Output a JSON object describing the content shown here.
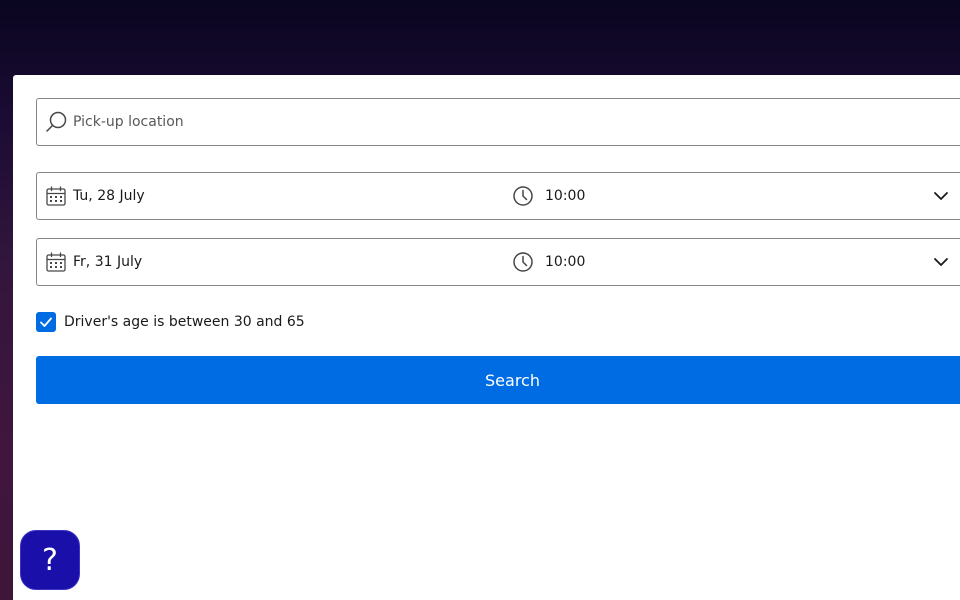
{
  "search": {
    "placeholder": "Pick-up location",
    "icon": "search-icon"
  },
  "pickup": {
    "date": "Tu, 28 July",
    "time": "10:00"
  },
  "dropoff": {
    "date": "Fr, 31 July",
    "time": "10:00"
  },
  "driver_age": {
    "checked": true,
    "label": "Driver's age is between 30 and 65"
  },
  "search_button": {
    "label": "Search"
  },
  "help": {
    "label": "?"
  },
  "colors": {
    "primary": "#006ce4",
    "help_button": "#1a0fa8"
  }
}
